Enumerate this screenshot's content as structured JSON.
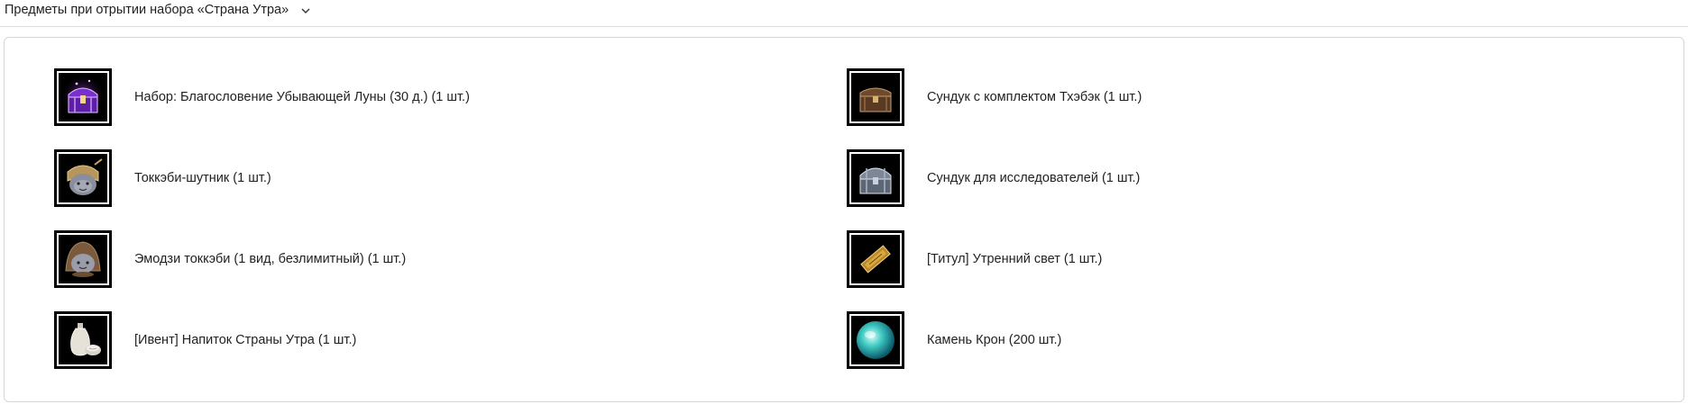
{
  "header": {
    "title": "Предметы при отрытии набора «Страна Утра»",
    "toggle_icon": "chevron-down-icon"
  },
  "items_left": [
    {
      "icon": "purple-chest-icon",
      "label": "Набор: Благословение Убывающей Луны (30 д.) (1 шт.)"
    },
    {
      "icon": "tokkaebi-prankster-icon",
      "label": "Токкэби-шутник (1 шт.)"
    },
    {
      "icon": "tokkaebi-emoji-icon",
      "label": "Эмодзи токкэби (1 вид, безлимитный) (1 шт.)"
    },
    {
      "icon": "drink-bottle-icon",
      "label": "[Ивент] Напиток Страны Утра (1 шт.)"
    }
  ],
  "items_right": [
    {
      "icon": "wooden-chest-icon",
      "label": "Сундук с комплектом Тхэбэк (1 шт.)"
    },
    {
      "icon": "explorer-chest-icon",
      "label": "Сундук для исследователей (1 шт.)"
    },
    {
      "icon": "title-scroll-icon",
      "label": "[Титул] Утренний свет (1 шт.)"
    },
    {
      "icon": "cron-stone-icon",
      "label": "Камень Крон (200 шт.)"
    }
  ],
  "colors": {
    "frame": "#000000",
    "frame_border": "#ffffff",
    "panel_border": "#d6d6d6",
    "text": "#222222"
  }
}
